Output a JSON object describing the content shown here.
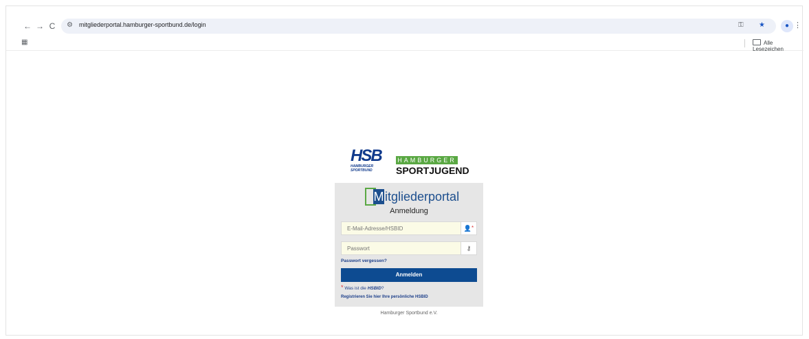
{
  "browser": {
    "url": "mitgliederportal.hamburger-sportbund.de/login",
    "bookmarks_folder": "Alle Lesezeichen"
  },
  "logos": {
    "hsb_mark": "HSB",
    "hsb_sub_line1": "HAMBURGER",
    "hsb_sub_line2": "SPORTBUND",
    "hj_top": "HAMBURGER",
    "hj_bottom": "SPORTJUGEND"
  },
  "portal": {
    "logo_m": "M",
    "logo_text": "itgliederportal",
    "subtitle": "Anmeldung"
  },
  "form": {
    "email_placeholder": "E-Mail-Adresse/HSBID",
    "password_placeholder": "Passwort",
    "forgot_link": "Passwort vergessen?",
    "login_button": "Anmelden",
    "hsbid_question_prefix": "Was ist die ",
    "hsbid_question_term": "HSBID",
    "hsbid_question_suffix": "?",
    "register_link": "Registrieren Sie hier Ihre persönliche HSBID"
  },
  "footer": {
    "text": "Hamburger Sportbund e.V."
  },
  "colors": {
    "primary_blue": "#0d4b91",
    "accent_green": "#5aa843",
    "link_blue": "#1d3f8a"
  }
}
